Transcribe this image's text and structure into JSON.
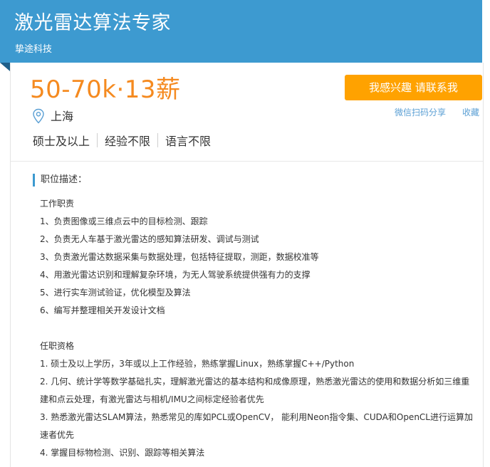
{
  "header": {
    "title": "激光雷达算法专家",
    "company": "挚途科技"
  },
  "job": {
    "salary": "50-70k·13薪",
    "city": "上海",
    "requirements": [
      "硕士及以上",
      "经验不限",
      "语言不限"
    ]
  },
  "actions": {
    "apply_label": "我感兴趣 请联系我",
    "share_label": "微信扫码分享",
    "favorite_label": "收藏"
  },
  "description": {
    "heading": "职位描述：",
    "duties_title": "工作职责",
    "duties": [
      "1、负责图像或三维点云中的目标检测、跟踪",
      "2、负责无人车基于激光雷达的感知算法研发、调试与测试",
      "3、负责激光雷达数据采集与数据处理，包括特征提取，测距，数据校准等",
      "4、用激光雷达识别和理解复杂环境，为无人驾驶系统提供强有力的支撑",
      "5、进行实车测试验证，优化模型及算法",
      "6、编写并整理相关开发设计文档"
    ],
    "qualifications_title": "任职资格",
    "qualifications": [
      "1. 硕士及以上学历，3年或以上工作经验，熟练掌握Linux，熟练掌握C++/Python",
      "2. 几何、统计学等数学基础扎实，理解激光雷达的基本结构和成像原理，熟悉激光雷达的使用和数据分析如三维重建和点云处理，有激光雷达与相机/IMU之间标定经验者优先",
      "3. 熟悉激光雷达SLAM算法，熟悉常见的库如PCL或OpenCV， 能利用Neon指令集、CUDA和OpenCL进行运算加速者优先",
      "4. 掌握目标物检测、识别、跟踪等相关算法"
    ]
  },
  "colors": {
    "banner": "#3d9ad0",
    "salary": "#f58a1f",
    "button": "#ffa200",
    "link": "#5a9fd4"
  },
  "icons": {
    "location": "map-pin-icon"
  }
}
